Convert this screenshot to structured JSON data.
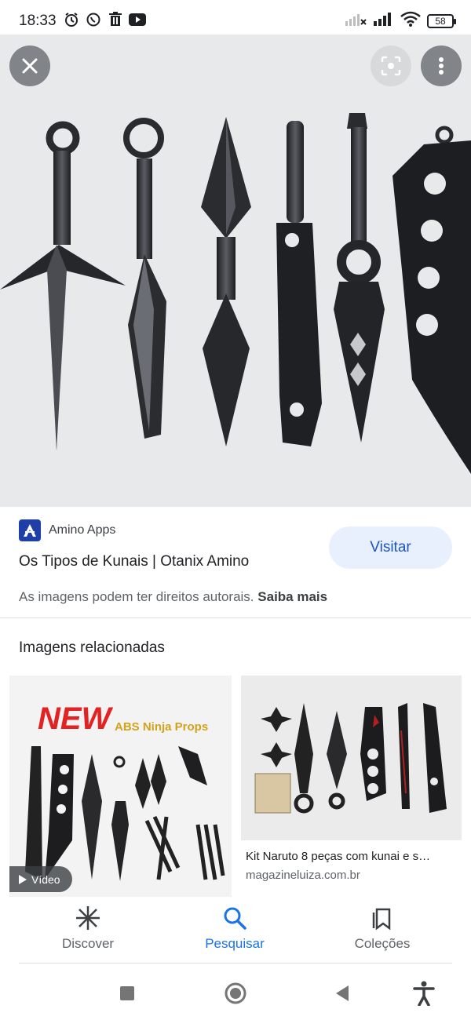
{
  "status": {
    "time": "18:33",
    "battery": "58"
  },
  "viewer": {
    "source_name": "Amino Apps",
    "title": "Os Tipos de Kunais | Otanix Amino",
    "visit_label": "Visitar",
    "copyright_text": "As imagens podem ter direitos autorais.",
    "copyright_link": "Saiba mais"
  },
  "related": {
    "heading": "Imagens relacionadas",
    "items": [
      {
        "badge": "Vídeo",
        "image_text_1": "NEW",
        "image_text_2": "ABS Ninja Props"
      },
      {
        "title": "Kit Naruto 8 peças com kunai e s…",
        "domain": "magazineluiza.com.br"
      }
    ]
  },
  "bottom_nav": {
    "items": [
      {
        "label": "Discover",
        "icon": "asterisk-icon"
      },
      {
        "label": "Pesquisar",
        "icon": "search-icon",
        "active": true
      },
      {
        "label": "Coleções",
        "icon": "collections-icon"
      }
    ]
  },
  "colors": {
    "accent": "#1a73e8",
    "visit_bg": "#e8f0fe"
  }
}
